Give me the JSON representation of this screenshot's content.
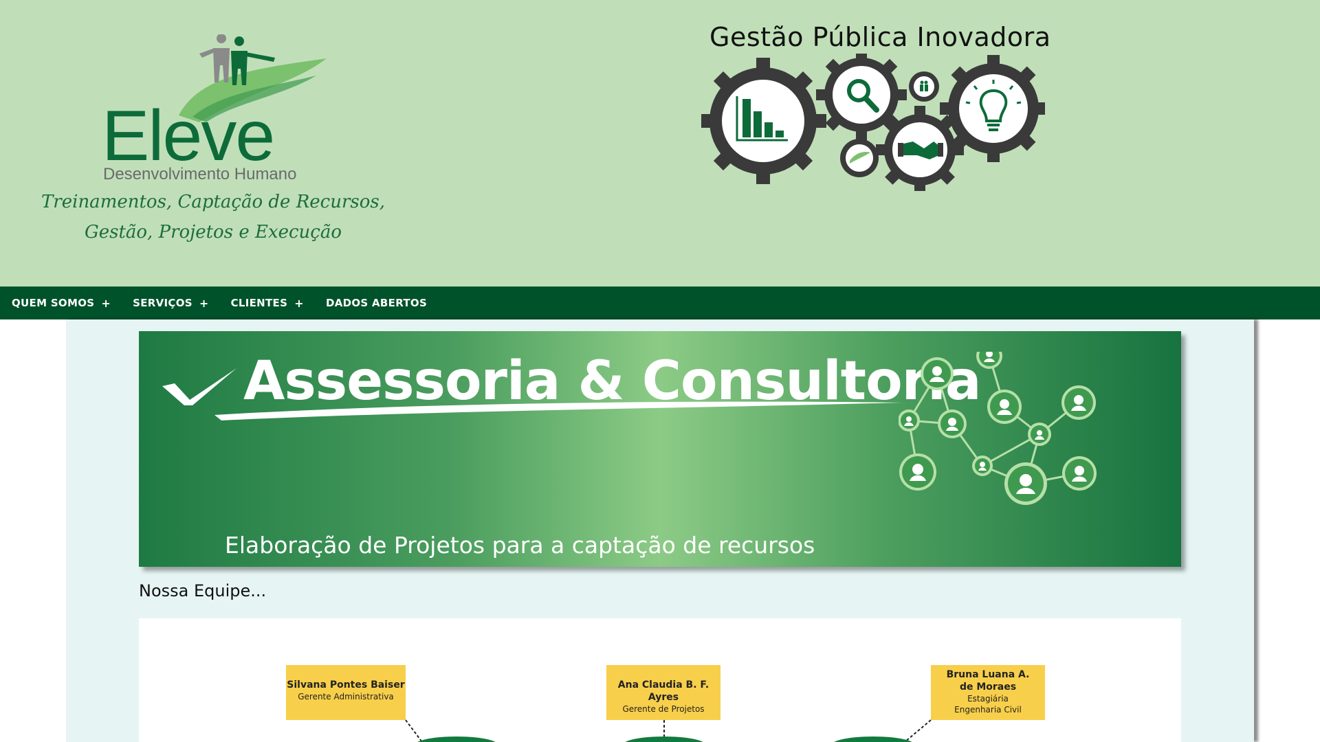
{
  "header": {
    "logo": {
      "wordmark": "Eleve",
      "subtitle": "Desenvolvimento Humano",
      "tagline_line1": "Treinamentos, Captação de Recursos,",
      "tagline_line2": "Gestão, Projetos e Execução"
    },
    "badge_title": "Gestão Pública Inovadora"
  },
  "nav": {
    "items": [
      {
        "label": "QUEM SOMOS",
        "expandable": true
      },
      {
        "label": "SERVIÇOS",
        "expandable": true
      },
      {
        "label": "CLIENTES",
        "expandable": true
      },
      {
        "label": "DADOS ABERTOS",
        "expandable": false
      }
    ],
    "expand_symbol": "+"
  },
  "banner": {
    "title": "Assessoria & Consultoria",
    "subtitle": "Elaboração de Projetos para a captação de recursos"
  },
  "team": {
    "heading": "Nossa Equipe...",
    "members": [
      {
        "name": "Silvana Pontes Baiser",
        "role": "Gerente Administrativa"
      },
      {
        "name": "Ana Claudia B. F. Ayres",
        "role": "Gerente de Projetos"
      },
      {
        "name_line1": "Bruna Luana A.",
        "name_line2": "de Moraes",
        "role_line1": "Estagiária",
        "role_line2": "Engenharia Civil"
      }
    ]
  },
  "colors": {
    "header_bg": "#c0dfb8",
    "nav_bg": "#00522b",
    "brand_green": "#0d6b3a",
    "content_bg": "#e6f5f3",
    "card_yellow": "#f8cf4a",
    "gear_dark": "#3a3a3a"
  }
}
